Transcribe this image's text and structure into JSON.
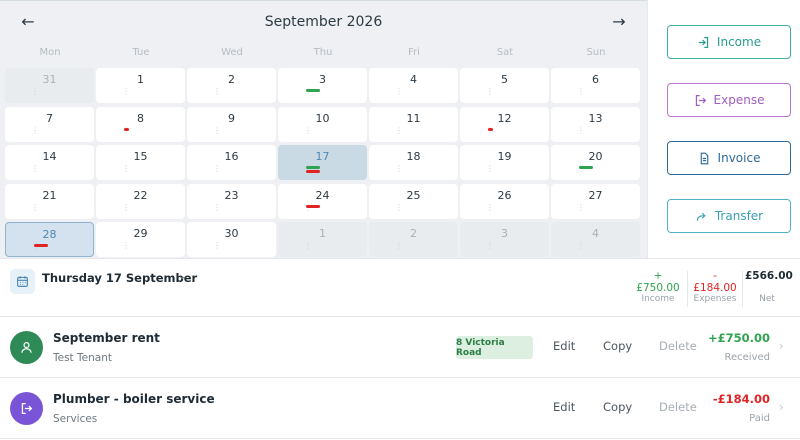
{
  "calendar": {
    "title": "September 2026",
    "weekdays": [
      "Mon",
      "Tue",
      "Wed",
      "Thu",
      "Fri",
      "Sat",
      "Sun"
    ],
    "days": [
      {
        "n": "31",
        "other": true
      },
      {
        "n": "1"
      },
      {
        "n": "2"
      },
      {
        "n": "3",
        "bars": [
          "green"
        ]
      },
      {
        "n": "4"
      },
      {
        "n": "5"
      },
      {
        "n": "6"
      },
      {
        "n": "7"
      },
      {
        "n": "8",
        "dots": [
          "red"
        ]
      },
      {
        "n": "9"
      },
      {
        "n": "10"
      },
      {
        "n": "11"
      },
      {
        "n": "12",
        "dots": [
          "red"
        ]
      },
      {
        "n": "13"
      },
      {
        "n": "14"
      },
      {
        "n": "15"
      },
      {
        "n": "16"
      },
      {
        "n": "17",
        "selected": true,
        "bars": [
          "green",
          "red"
        ]
      },
      {
        "n": "18"
      },
      {
        "n": "19"
      },
      {
        "n": "20",
        "bars": [
          "green"
        ]
      },
      {
        "n": "21"
      },
      {
        "n": "22"
      },
      {
        "n": "23"
      },
      {
        "n": "24",
        "bars": [
          "red"
        ]
      },
      {
        "n": "25"
      },
      {
        "n": "26"
      },
      {
        "n": "27"
      },
      {
        "n": "28",
        "today": true,
        "bars": [
          "red"
        ]
      },
      {
        "n": "29"
      },
      {
        "n": "30"
      },
      {
        "n": "1",
        "other": true
      },
      {
        "n": "2",
        "other": true
      },
      {
        "n": "3",
        "other": true
      },
      {
        "n": "4",
        "other": true
      }
    ]
  },
  "actions": {
    "income": "Income",
    "expense": "Expense",
    "invoice": "Invoice",
    "transfer": "Transfer"
  },
  "summary": {
    "date": "Thursday 17 September",
    "income_value": "+ £750.00",
    "income_label": "Income",
    "expenses_value": "- £184.00",
    "expenses_label": "Expenses",
    "net_value": "£566.00",
    "net_label": "Net"
  },
  "transactions": [
    {
      "title": "September rent",
      "subtitle": "Test Tenant",
      "tag": "8 Victoria Road",
      "edit": "Edit",
      "copy": "Copy",
      "delete": "Delete",
      "amount": "+£750.00",
      "status": "Received"
    },
    {
      "title": "Plumber - boiler service",
      "subtitle": "Services",
      "edit": "Edit",
      "copy": "Copy",
      "delete": "Delete",
      "amount": "-£184.00",
      "status": "Paid"
    }
  ],
  "colors": {
    "income": "#2fa34f",
    "expense": "#e02424",
    "accent": "#2e6a98"
  }
}
